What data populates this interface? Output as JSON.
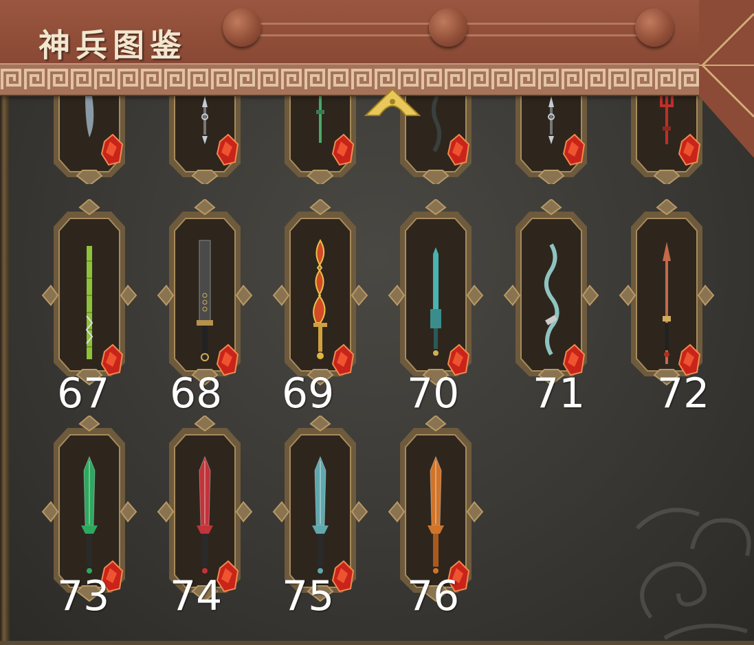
{
  "title": "神兵图鉴",
  "colors": {
    "header": "#8c4b36",
    "panel": "#3a3834",
    "frame_gold": "#a88b5c",
    "card_inner": "#2e261d",
    "gem_red": "#c9241a",
    "label": "#ffffff"
  },
  "scroll_up_icon": "gold-arrow-up-icon",
  "rows": [
    {
      "partial": true,
      "items": [
        {
          "weapon": "curved-blade-icon",
          "color": "#8a9aa6"
        },
        {
          "weapon": "silver-spear-icon",
          "color": "#c4ccd4"
        },
        {
          "weapon": "green-spear-icon",
          "color": "#4aa86a"
        },
        {
          "weapon": "twisted-staff-icon",
          "color": "#39403f"
        },
        {
          "weapon": "silver-halberd-icon",
          "color": "#c4ccd4"
        },
        {
          "weapon": "red-trident-icon",
          "color": "#c0302a"
        }
      ]
    },
    {
      "partial": false,
      "items": [
        {
          "label": "67",
          "weapon": "bamboo-staff-icon",
          "color": "#8dc23a"
        },
        {
          "label": "68",
          "weapon": "black-sabre-icon",
          "color": "#4a4a4a"
        },
        {
          "label": "69",
          "weapon": "flame-sword-icon",
          "color": "#d24a26"
        },
        {
          "label": "70",
          "weapon": "cyan-sword-icon",
          "color": "#4ab2b0"
        },
        {
          "label": "71",
          "weapon": "serpent-blade-icon",
          "color": "#8fc3c0"
        },
        {
          "label": "72",
          "weapon": "copper-spear-icon",
          "color": "#c46a4a"
        }
      ]
    },
    {
      "partial": false,
      "items": [
        {
          "label": "73",
          "weapon": "jade-sword-icon",
          "color": "#2ea860"
        },
        {
          "label": "74",
          "weapon": "crimson-sword-icon",
          "color": "#c0343a"
        },
        {
          "label": "75",
          "weapon": "steel-sword-icon",
          "color": "#5fa8ae"
        },
        {
          "label": "76",
          "weapon": "bronze-sword-icon",
          "color": "#d0742a"
        }
      ]
    }
  ]
}
